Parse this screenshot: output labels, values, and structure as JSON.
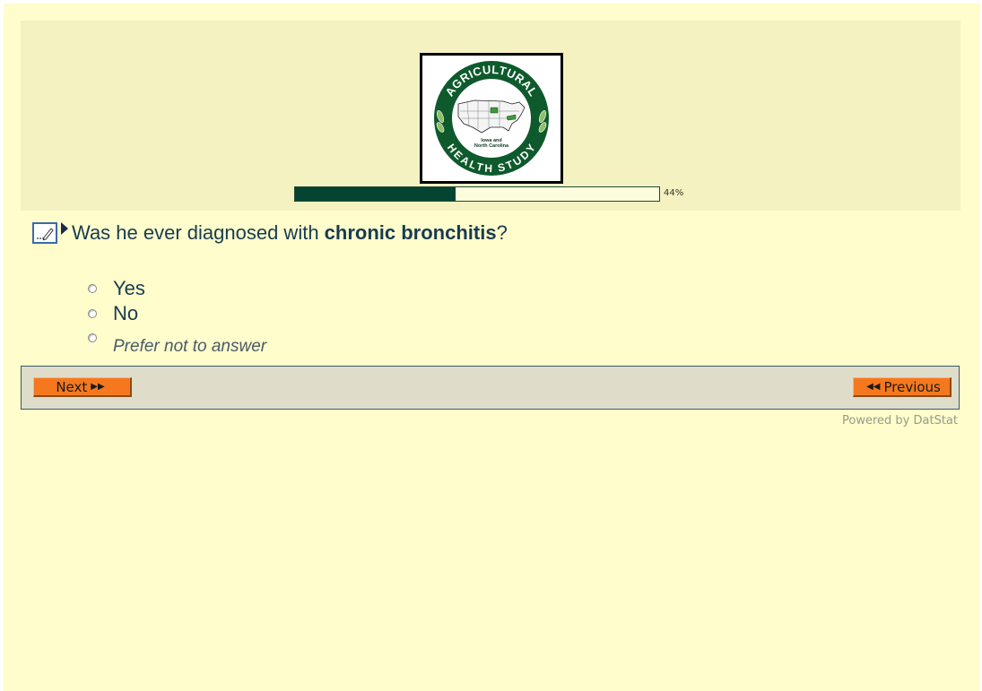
{
  "header": {
    "logo": {
      "ring_top_text": "AGRICULTURAL",
      "ring_bottom_text": "HEALTH STUDY",
      "map_caption_line1": "Iowa and",
      "map_caption_line2": "North Carolina",
      "ring_color": "#0e5a2c"
    },
    "progress": {
      "value": 0.44,
      "label": "44%",
      "fill_color": "#044431"
    }
  },
  "question": {
    "text_before": "Was he ever diagnosed with ",
    "text_bold": "chronic bronchitis",
    "text_after": "?",
    "edit_icon": "pencil-edit-icon",
    "marker_icon": "triangle-right-icon"
  },
  "options": [
    {
      "label": "Yes",
      "selected": false
    },
    {
      "label": "No",
      "selected": false
    },
    {
      "label": "Prefer not to answer",
      "selected": false
    }
  ],
  "nav": {
    "next_label": "Next",
    "next_icon": "double-chevron-right-icon",
    "previous_label": "Previous",
    "previous_icon": "double-chevron-left-icon",
    "button_color": "#f5781e"
  },
  "footer": {
    "powered_by": "Powered by DatStat"
  }
}
